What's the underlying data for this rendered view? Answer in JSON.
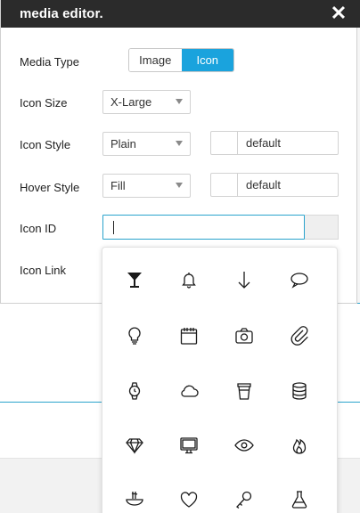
{
  "dialog": {
    "title": "media editor.",
    "close_glyph": "✕"
  },
  "fields": {
    "media_type": {
      "label": "Media Type",
      "options": [
        "Image",
        "Icon"
      ],
      "selected": "Icon"
    },
    "icon_size": {
      "label": "Icon Size",
      "value": "X-Large"
    },
    "icon_style": {
      "label": "Icon Style",
      "value": "Plain",
      "color_value": "default"
    },
    "hover_style": {
      "label": "Hover Style",
      "value": "Fill",
      "color_value": "default"
    },
    "icon_id": {
      "label": "Icon ID",
      "value": ""
    },
    "icon_link": {
      "label": "Icon Link"
    }
  },
  "picker": {
    "icons": [
      "cocktail-glass-icon",
      "bell-icon",
      "arrow-down-icon",
      "speech-bubble-icon",
      "lightbulb-icon",
      "calendar-icon",
      "camera-icon",
      "paperclip-icon",
      "watch-icon",
      "cloud-icon",
      "coffee-cup-icon",
      "database-icon",
      "diamond-icon",
      "monitor-icon",
      "eye-icon",
      "flame-icon",
      "noodle-bowl-icon",
      "heart-icon",
      "key-icon",
      "flask-icon"
    ]
  },
  "colors": {
    "accent": "#1aa3dd",
    "titlebar": "#2b2b2b",
    "divider": "#2aa3cc"
  }
}
